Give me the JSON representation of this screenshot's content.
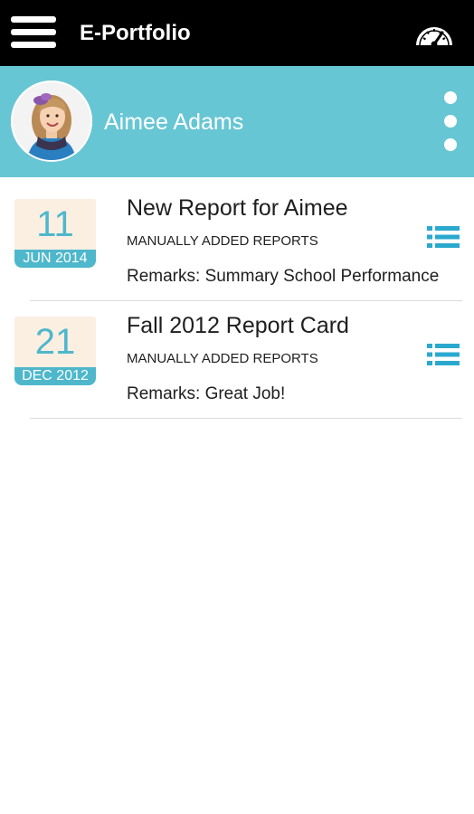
{
  "topbar": {
    "title": "E-Portfolio",
    "menu_icon": "hamburger-menu-icon",
    "dashboard_icon": "speedometer-icon"
  },
  "profile": {
    "name": "Aimee Adams",
    "avatar": "student-photo",
    "more_icon": "vertical-ellipsis-icon"
  },
  "reports": [
    {
      "day": "11",
      "month_year": "JUN 2014",
      "title": "New Report for Aimee",
      "category": "MANUALLY ADDED REPORTS",
      "remarks": "Remarks: Summary School Performance",
      "action_icon": "list-icon"
    },
    {
      "day": "21",
      "month_year": "DEC 2012",
      "title": "Fall 2012 Report Card",
      "category": "MANUALLY ADDED REPORTS",
      "remarks": "Remarks: Great Job!",
      "action_icon": "list-icon"
    }
  ],
  "colors": {
    "topbar_bg": "#000000",
    "profile_bg": "#67c6d4",
    "accent": "#4eb7cb",
    "date_bg": "#fbefe2",
    "text": "#1e1e1e"
  }
}
